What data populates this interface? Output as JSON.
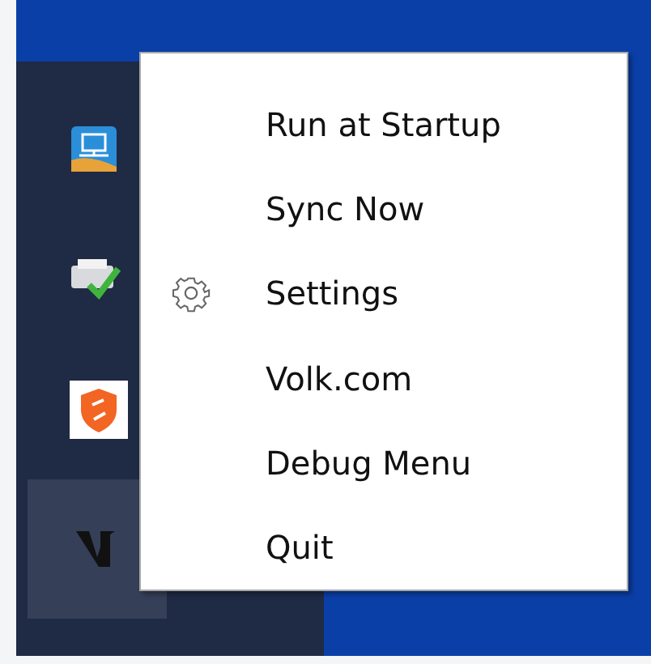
{
  "tray_icons": [
    {
      "kind": "network",
      "selected": false
    },
    {
      "kind": "printer",
      "selected": false
    },
    {
      "kind": "shield",
      "selected": false
    },
    {
      "kind": "logo",
      "selected": true
    }
  ],
  "context_menu": {
    "items": [
      {
        "label": "Run at Startup",
        "kind": "plain"
      },
      {
        "label": "Sync Now",
        "kind": "plain"
      },
      {
        "label": "Settings",
        "kind": "gear"
      },
      {
        "label": "Volk.com",
        "kind": "plain"
      },
      {
        "label": "Debug Menu",
        "kind": "plain"
      },
      {
        "label": "Quit",
        "kind": "plain"
      }
    ]
  }
}
